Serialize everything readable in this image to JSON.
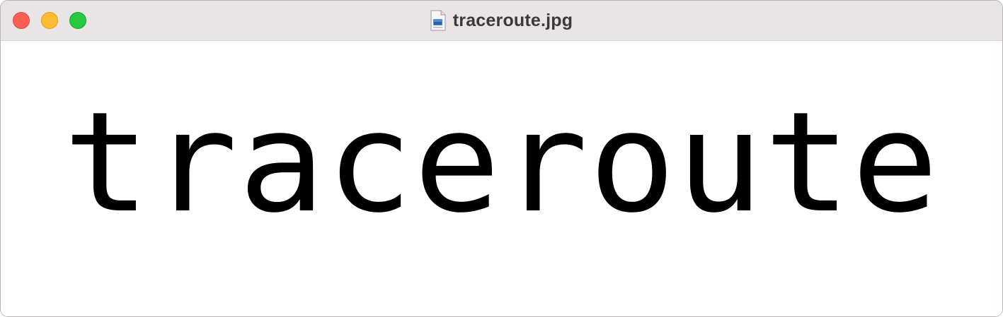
{
  "window": {
    "title": "traceroute.jpg",
    "title_icon": "document-image-icon"
  },
  "controls": {
    "close": "close-button",
    "minimize": "minimize-button",
    "zoom": "zoom-button"
  },
  "image": {
    "text": "traceroute"
  },
  "colors": {
    "titlebar": "#e9e4e6",
    "close": "#ff5f57",
    "minimize": "#febc2e",
    "zoom": "#28c840",
    "text": "#000000"
  }
}
